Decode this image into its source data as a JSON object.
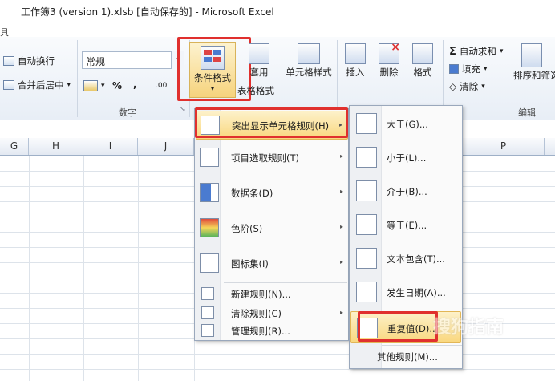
{
  "window": {
    "title": "工作簿3 (version 1).xlsb [自动保存的]  -  Microsoft Excel",
    "tab_fragment": "具"
  },
  "ribbon": {
    "wrap_text": "自动换行",
    "merge_center": "合并后居中",
    "number_format_value": "常规",
    "percent": "%",
    "comma": ",",
    "increase_decimal": ".00",
    "number_group": "数字",
    "conditional_format": "条件格式",
    "format_table_1": "套用",
    "format_table_2": "表格格式",
    "cell_styles": "单元格样式",
    "insert": "插入",
    "delete": "删除",
    "format": "格式",
    "autosum": "自动求和",
    "fill": "填充",
    "clear": "清除",
    "sort_filter": "排序和筛选",
    "edit_group": "编辑",
    "dropdown_arrow": "▾",
    "launcher": "↘"
  },
  "columns": [
    "G",
    "H",
    "I",
    "J",
    "P"
  ],
  "menu": {
    "items": [
      {
        "label": "突出显示单元格规则(H)",
        "arrow": "▸"
      },
      {
        "label": "项目选取规则(T)",
        "arrow": "▸"
      },
      {
        "label": "数据条(D)",
        "arrow": "▸"
      },
      {
        "label": "色阶(S)",
        "arrow": "▸"
      },
      {
        "label": "图标集(I)",
        "arrow": "▸"
      }
    ],
    "small_items": [
      {
        "label": "新建规则(N)..."
      },
      {
        "label": "清除规则(C)",
        "arrow": "▸"
      },
      {
        "label": "管理规则(R)..."
      }
    ]
  },
  "submenu": {
    "items": [
      {
        "label": "大于(G)..."
      },
      {
        "label": "小于(L)..."
      },
      {
        "label": "介于(B)..."
      },
      {
        "label": "等于(E)..."
      },
      {
        "label": "文本包含(T)..."
      },
      {
        "label": "发生日期(A)..."
      },
      {
        "label": "重复值(D)..."
      }
    ],
    "other": "其他规则(M)..."
  },
  "watermark": "搜狗指南"
}
